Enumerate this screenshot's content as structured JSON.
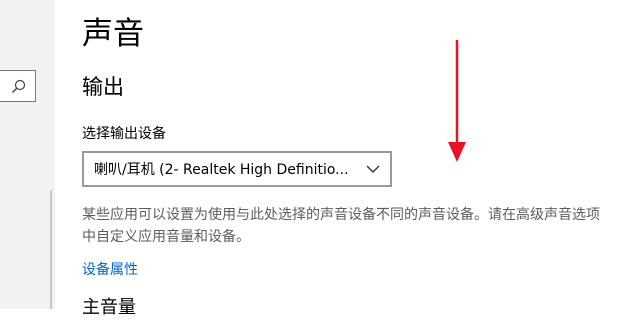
{
  "page": {
    "title": "声音"
  },
  "sidebar": {
    "search_icon": "search-icon"
  },
  "output": {
    "section_title": "输出",
    "device_label": "选择输出设备",
    "selected_device": "喇叭/耳机 (2- Realtek High Definitio...",
    "description": "某些应用可以设置为使用与此处选择的声音设备不同的声音设备。请在高级声音选项中自定义应用音量和设备。",
    "device_properties_link": "设备属性",
    "next_heading_partial": "主音量"
  },
  "annotation": {
    "arrow_color": "#e81123"
  }
}
